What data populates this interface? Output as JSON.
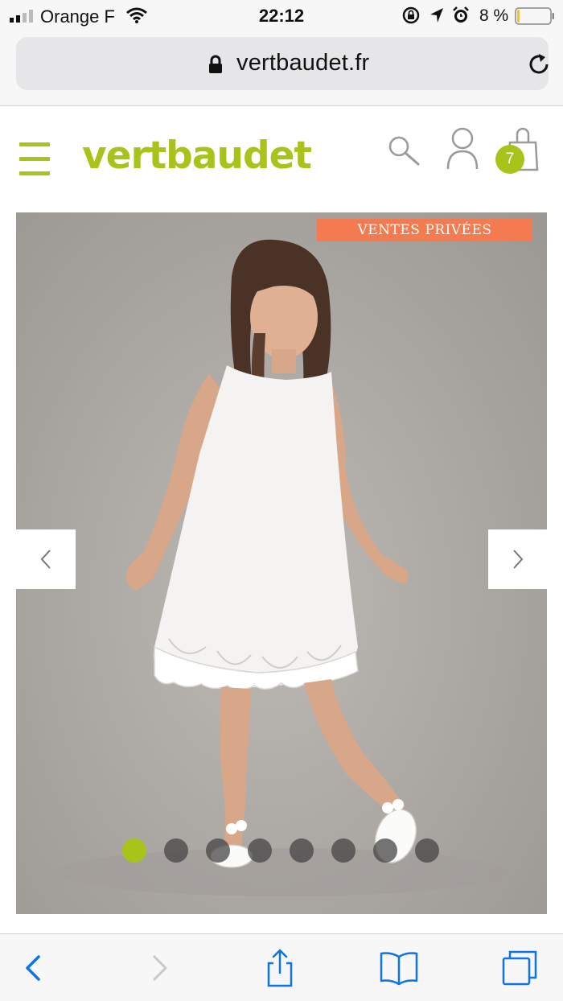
{
  "status_bar": {
    "carrier": "Orange F",
    "time": "22:12",
    "battery_percent": "8 %",
    "battery_level": 0.08,
    "icons": [
      "signal-icon",
      "wifi-icon",
      "rotation-lock-icon",
      "location-icon",
      "alarm-icon",
      "battery-icon"
    ]
  },
  "browser": {
    "url": "vertbaudet.fr",
    "icons": [
      "lock-icon",
      "reload-icon"
    ]
  },
  "header": {
    "logo": "vertbaudet",
    "cart_count": "7",
    "icons": [
      "menu-icon",
      "search-icon",
      "account-icon",
      "cart-icon"
    ],
    "colors": {
      "brand": "#a8c41b"
    }
  },
  "carousel": {
    "promo_tag": "VENTES PRIVÉES",
    "slide_count": 8,
    "active_slide": 1,
    "icons": [
      "chevron-left-icon",
      "chevron-right-icon"
    ],
    "colors": {
      "promo": "#f47a50",
      "active_dot": "#a8c41b"
    }
  },
  "toolbar": {
    "icons": [
      "back-icon",
      "forward-icon",
      "share-icon",
      "bookmarks-icon",
      "tabs-icon"
    ]
  }
}
